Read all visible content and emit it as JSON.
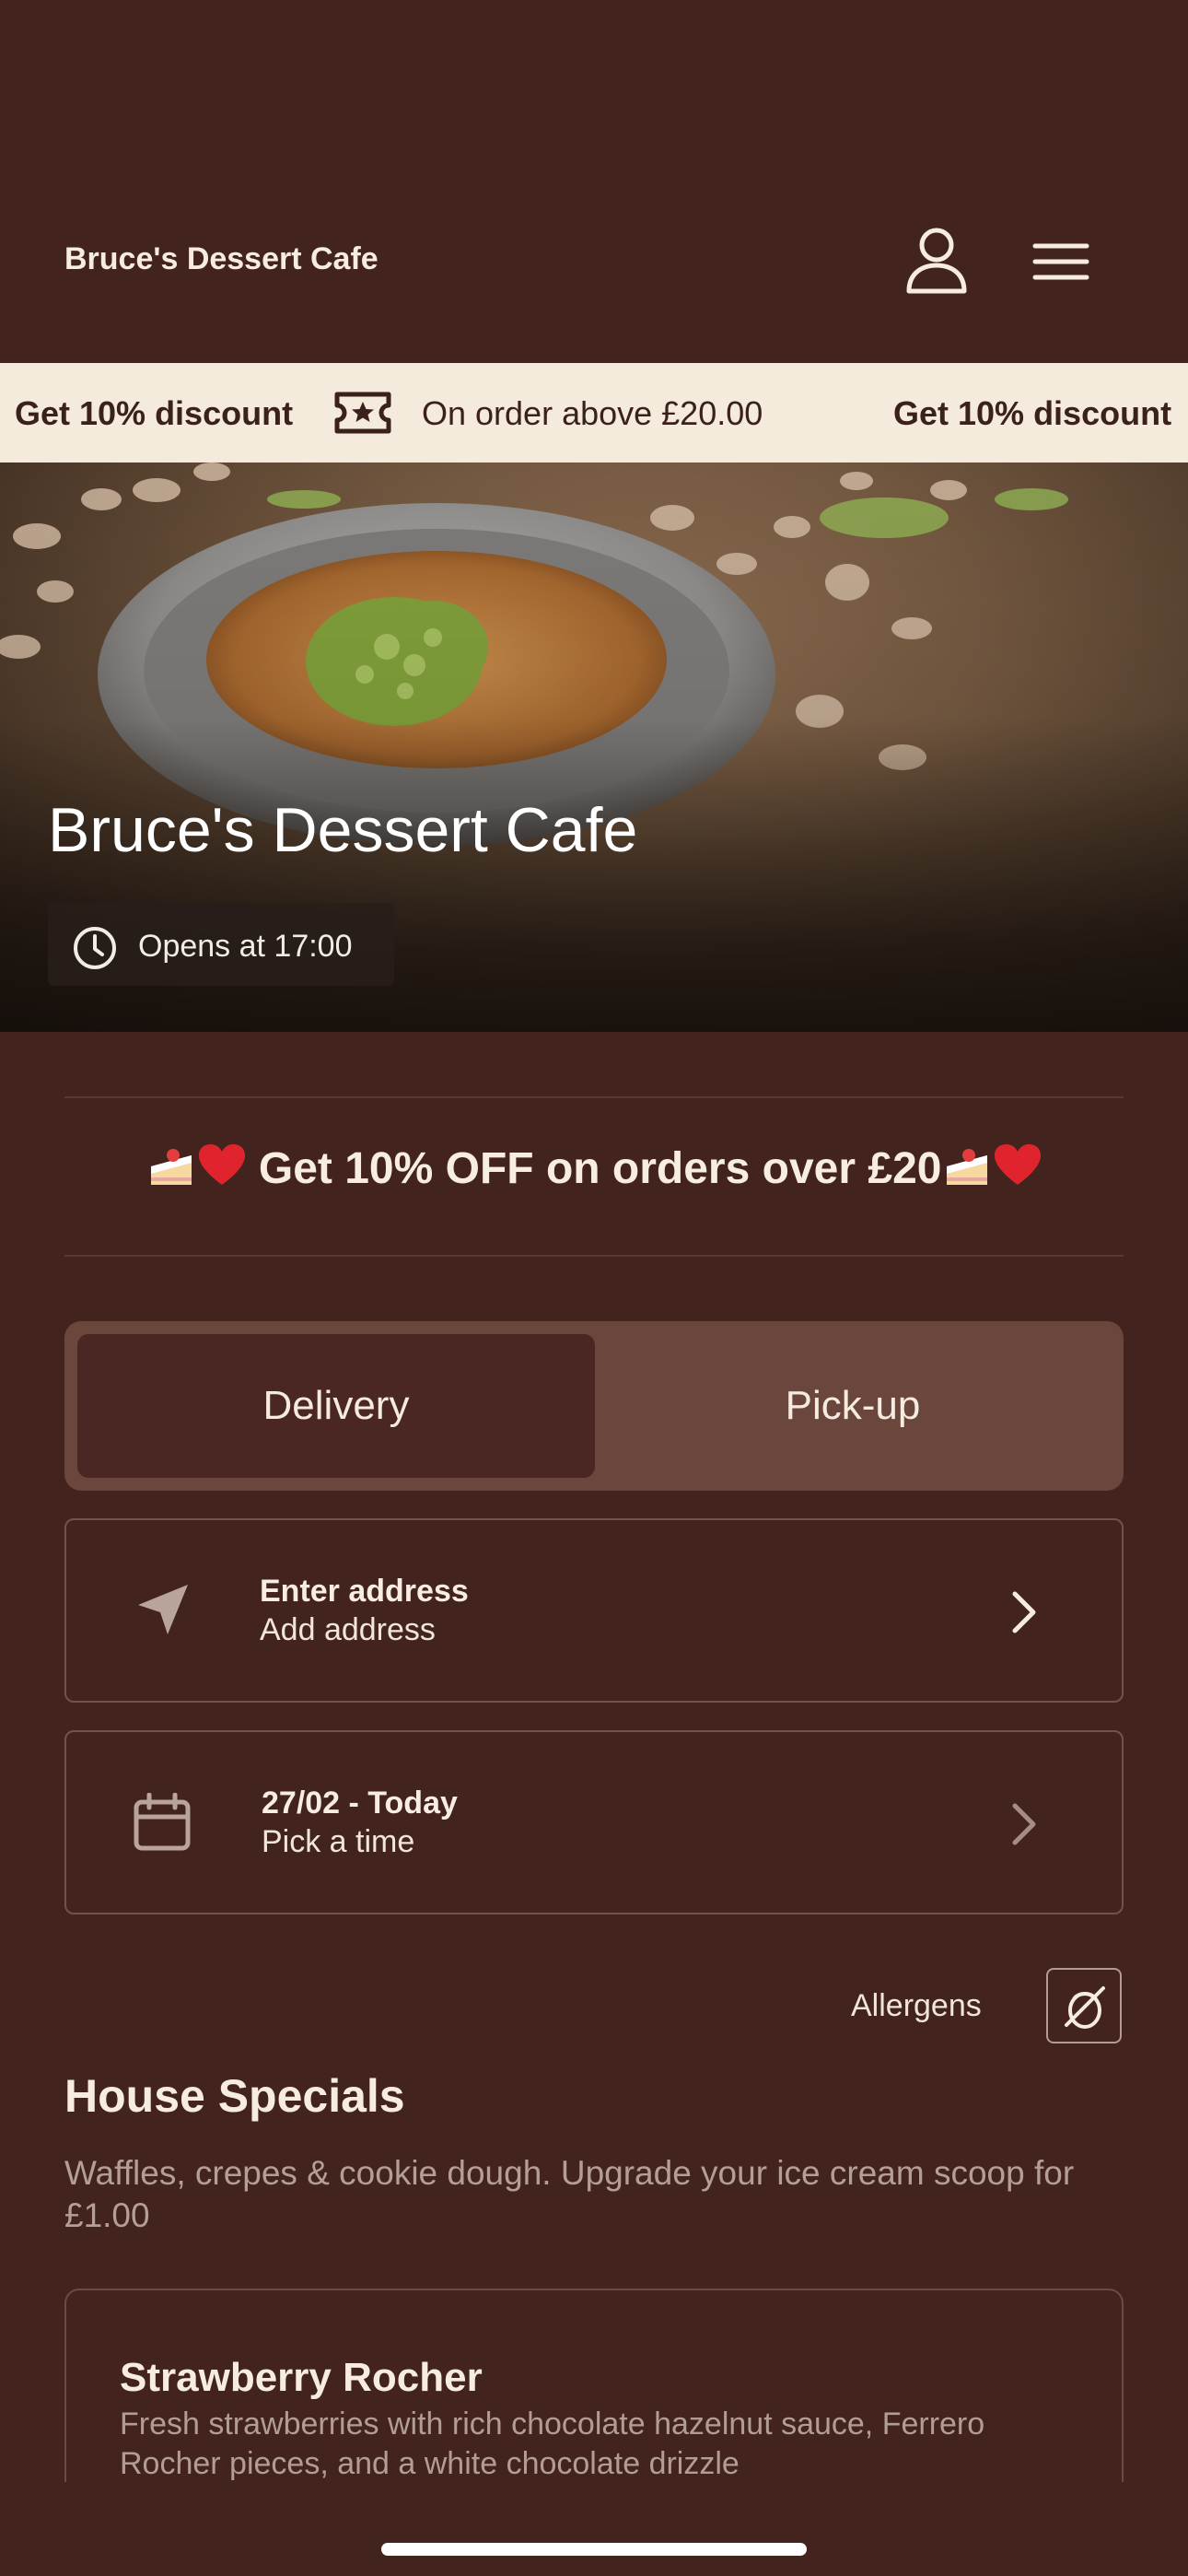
{
  "header": {
    "brand": "Bruce's Dessert Cafe",
    "icons": [
      "user-icon",
      "menu-icon"
    ]
  },
  "ticker": {
    "left_bold": "Get 10% discount",
    "middle": "On order above £20.00",
    "right_bold": "Get 10% discount",
    "icon": "ticket-star-icon"
  },
  "hero": {
    "title": "Bruce's Dessert Cafe",
    "hours": "Opens at 17:00"
  },
  "promo": {
    "text": " Get 10% OFF on orders over £20",
    "emojis": [
      "cake",
      "red-heart"
    ]
  },
  "fulfillment": {
    "options": [
      "Delivery",
      "Pick-up"
    ],
    "selected": "Delivery"
  },
  "address": {
    "title": "Enter address",
    "subtitle": "Add address"
  },
  "schedule": {
    "title": "27/02 - Today",
    "subtitle": "Pick a time"
  },
  "allergens": {
    "label": "Allergens"
  },
  "section": {
    "title": "House Specials",
    "description": "Waffles, crepes & cookie dough. Upgrade your ice cream scoop for £1.00"
  },
  "items": [
    {
      "name": "Strawberry Rocher",
      "description": "Fresh strawberries with rich chocolate hazelnut sauce, Ferrero Rocher pieces, and a white chocolate drizzle"
    }
  ],
  "colors": {
    "background": "#42231e",
    "ticker_bg": "#f4ebdc",
    "toggle_bg": "#6a463d",
    "toggle_selected": "#4a2722"
  }
}
